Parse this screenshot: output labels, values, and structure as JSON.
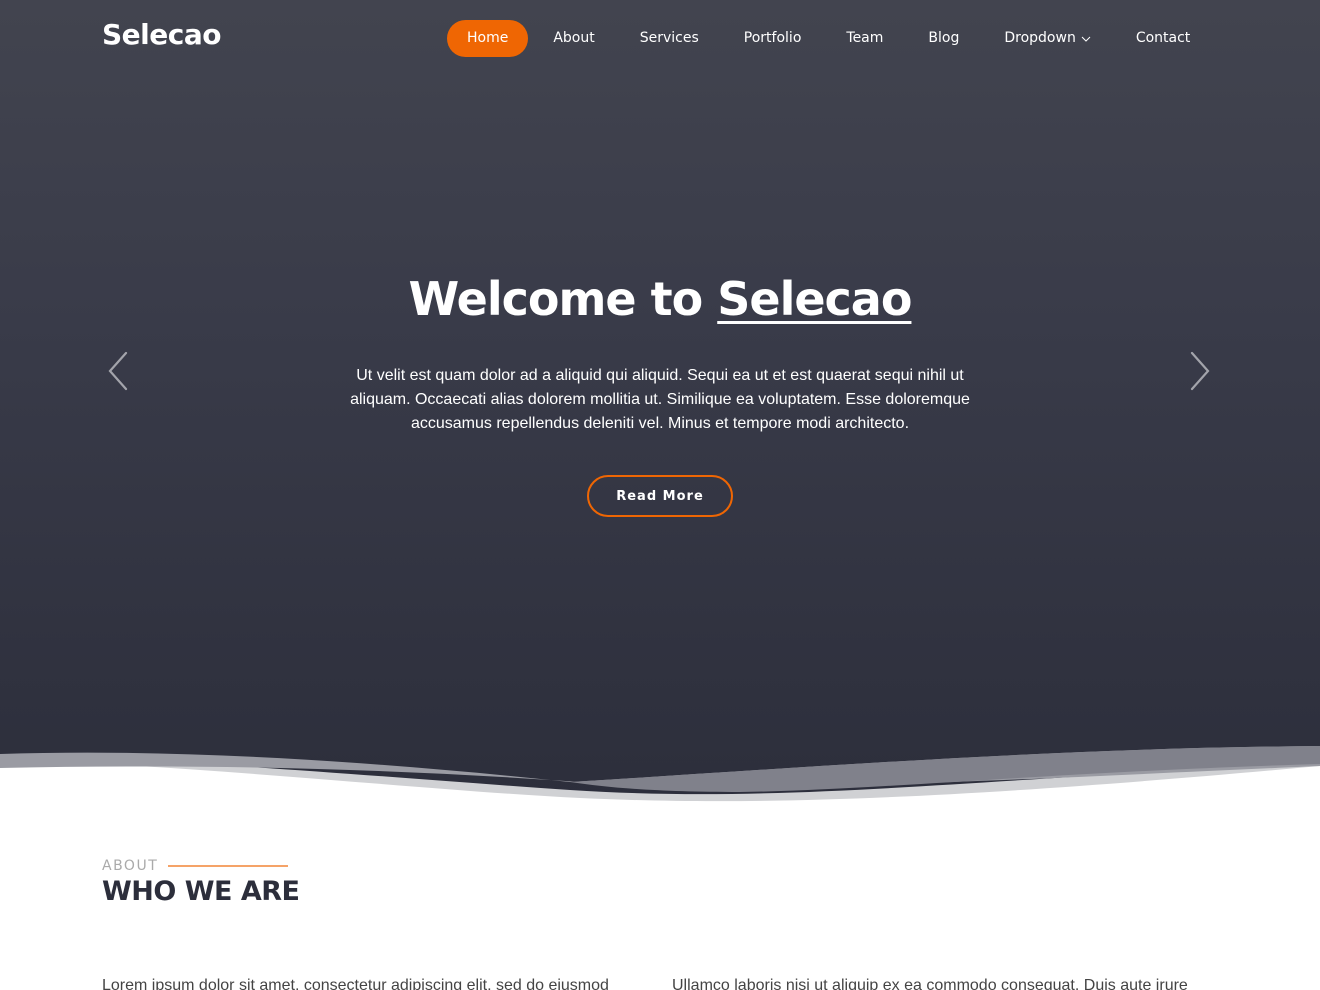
{
  "brand": {
    "logo_text": "Selecao",
    "accent_color": "#ef6603"
  },
  "nav": {
    "items": [
      {
        "label": "Home",
        "active": true
      },
      {
        "label": "About"
      },
      {
        "label": "Services"
      },
      {
        "label": "Portfolio"
      },
      {
        "label": "Team"
      },
      {
        "label": "Blog"
      },
      {
        "label": "Dropdown",
        "has_dropdown": true,
        "icon": "chevron-down-icon"
      },
      {
        "label": "Contact"
      }
    ]
  },
  "hero": {
    "title_prefix": "Welcome to ",
    "title_brand": "Selecao",
    "text": "Ut velit est quam dolor ad a aliquid qui aliquid. Sequi ea ut et est quaerat sequi nihil ut aliquam. Occaecati alias dolorem mollitia ut. Similique ea voluptatem. Esse doloremque accusamus repellendus deleniti vel. Minus et tempore modi architecto.",
    "cta_label": "Read More",
    "prev_icon": "chevron-left-icon",
    "next_icon": "chevron-right-icon"
  },
  "about": {
    "label": "ABOUT",
    "title": "WHO WE ARE",
    "col_left_text": "Lorem ipsum dolor sit amet, consectetur adipiscing elit, sed do eiusmod",
    "col_right_text": "Ullamco laboris nisi ut aliquip ex ea commodo consequat. Duis aute irure"
  }
}
